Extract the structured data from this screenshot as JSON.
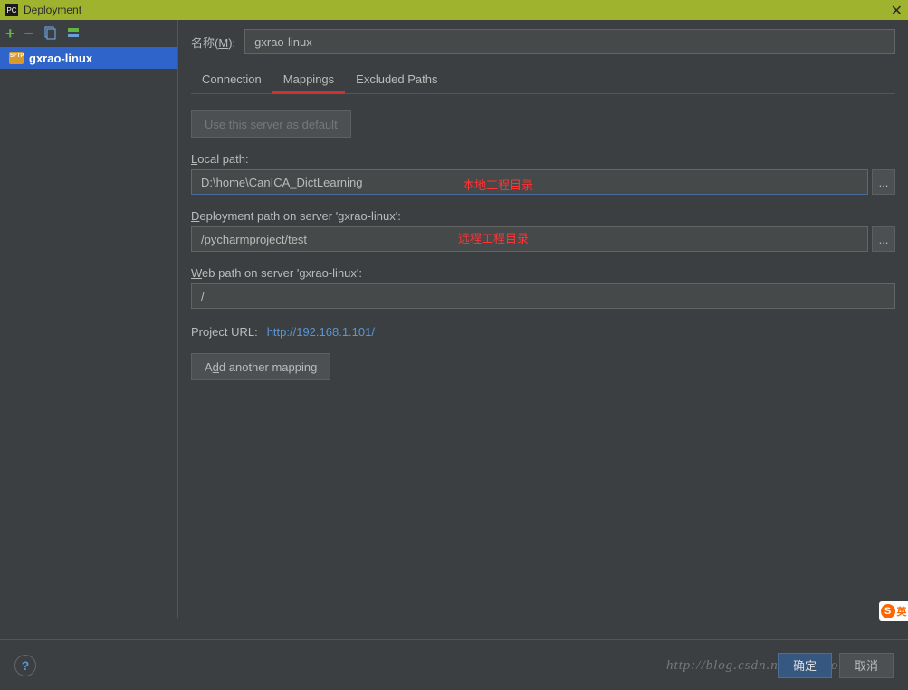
{
  "titlebar": {
    "icon": "PC",
    "title": "Deployment"
  },
  "toolbar": {
    "add": "+",
    "remove": "−",
    "copy": "⿻",
    "deploy": "⇩"
  },
  "sidebar": {
    "servers": [
      {
        "name": "gxrao-linux"
      }
    ]
  },
  "form": {
    "name_label_prefix": "名称(",
    "name_label_u": "M",
    "name_label_suffix": "):",
    "name_value": "gxrao-linux"
  },
  "tabs": {
    "connection": "Connection",
    "mappings": "Mappings",
    "excluded": "Excluded Paths",
    "active": "mappings"
  },
  "content": {
    "default_btn": "Use this server as default",
    "local_label_u": "L",
    "local_label_rest": "ocal path:",
    "local_value": "D:\\home\\CanICA_DictLearning",
    "annotation_local": "本地工程目录",
    "deploy_label_u": "D",
    "deploy_label_rest": "eployment path on server 'gxrao-linux':",
    "deploy_value": "/pycharmproject/test",
    "annotation_deploy": "远程工程目录",
    "web_label_u": "W",
    "web_label_rest": "eb path on server 'gxrao-linux':",
    "web_value": "/",
    "url_label": "Project URL:",
    "url_value": "http://192.168.1.101/",
    "add_mapping_pre": "A",
    "add_mapping_u": "d",
    "add_mapping_post": "d another mapping",
    "browse": "..."
  },
  "footer": {
    "help": "?",
    "ok": "确定",
    "cancel": "取消",
    "watermark": "http://blog.csdn.net/jinxiaonian11"
  },
  "badge": {
    "text": "英"
  }
}
